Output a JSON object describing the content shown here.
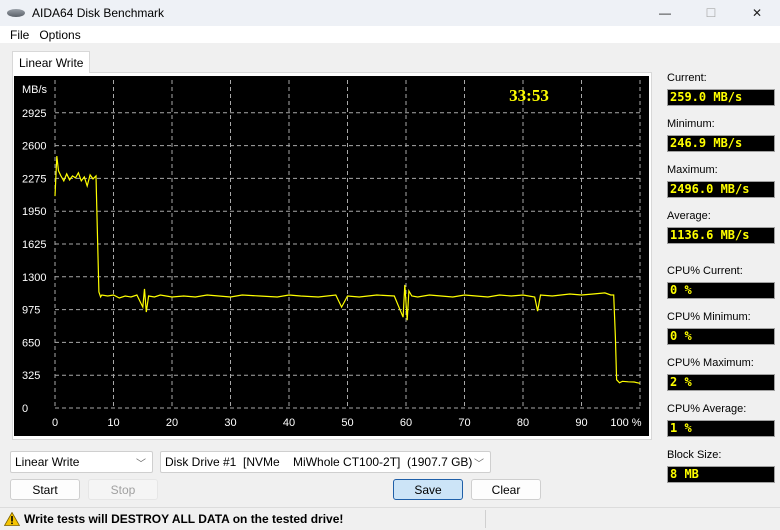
{
  "window": {
    "title": "AIDA64 Disk Benchmark",
    "controls": {
      "minimize": "—",
      "maximize": "☐",
      "close": "✕"
    }
  },
  "menu": [
    "File",
    "Options"
  ],
  "tab": {
    "label": "Linear Write"
  },
  "chart_data": {
    "type": "line",
    "title": "",
    "timer": "33:53",
    "ylabel": "MB/s",
    "xlabel": "%",
    "ylim": [
      0,
      3250
    ],
    "xlim": [
      0,
      100
    ],
    "yticks": [
      "0",
      "325",
      "650",
      "975",
      "1300",
      "1625",
      "1950",
      "2275",
      "2600",
      "2925"
    ],
    "yticks_values": [
      0,
      325,
      650,
      975,
      1300,
      1625,
      1950,
      2275,
      2600,
      2925
    ],
    "xticks": [
      "0",
      "10",
      "20",
      "30",
      "40",
      "50",
      "60",
      "70",
      "80",
      "90",
      "100 %"
    ],
    "xticks_values": [
      0,
      10,
      20,
      30,
      40,
      50,
      60,
      70,
      80,
      90,
      100
    ],
    "grid": true,
    "line_color": "#ffff00",
    "series": [
      {
        "name": "Linear Write",
        "x": [
          0,
          0.3,
          0.6,
          1,
          1.5,
          2,
          2.5,
          3,
          3.5,
          4,
          4.5,
          5,
          5.5,
          6,
          6.5,
          7,
          7.3,
          7.5,
          7.8,
          8,
          9,
          10,
          11,
          12,
          13,
          14,
          15,
          15.3,
          15.6,
          16,
          17,
          18,
          20,
          22,
          24,
          26,
          28,
          30,
          32,
          35,
          38,
          40,
          42,
          45,
          48,
          49,
          50,
          52,
          55,
          58,
          59.5,
          59.8,
          60.2,
          60.5,
          61,
          62,
          64,
          66,
          68,
          70,
          72,
          74,
          76,
          78,
          80,
          82,
          82.5,
          83,
          85,
          88,
          90,
          92,
          94,
          95,
          95.5,
          95.8,
          96,
          96.5,
          97,
          98,
          99,
          100
        ],
        "y": [
          2100,
          2496,
          2350,
          2300,
          2250,
          2320,
          2260,
          2300,
          2280,
          2330,
          2250,
          2290,
          2200,
          2310,
          2270,
          2300,
          1620,
          1150,
          1100,
          1120,
          1110,
          1120,
          1090,
          1110,
          1100,
          1120,
          1000,
          1180,
          950,
          1110,
          1100,
          1120,
          1100,
          1110,
          1100,
          1120,
          1110,
          1100,
          1120,
          1110,
          1100,
          1120,
          1110,
          1100,
          1120,
          1000,
          1110,
          1100,
          1120,
          1110,
          900,
          1220,
          870,
          1160,
          1110,
          1100,
          1120,
          1110,
          1100,
          1120,
          1110,
          1100,
          1120,
          1110,
          1120,
          1100,
          960,
          1120,
          1110,
          1130,
          1120,
          1130,
          1140,
          1120,
          1120,
          700,
          280,
          250,
          265,
          260,
          258,
          245
        ]
      }
    ]
  },
  "stats": [
    {
      "label": "Current:",
      "value": "259.0 MB/s"
    },
    {
      "label": "Minimum:",
      "value": "246.9 MB/s"
    },
    {
      "label": "Maximum:",
      "value": "2496.0 MB/s"
    },
    {
      "label": "Average:",
      "value": "1136.6 MB/s"
    },
    {
      "label": "CPU% Current:",
      "value": "0 %"
    },
    {
      "label": "CPU% Minimum:",
      "value": "0 %"
    },
    {
      "label": "CPU% Maximum:",
      "value": "2 %"
    },
    {
      "label": "CPU% Average:",
      "value": "1 %"
    },
    {
      "label": "Block Size:",
      "value": "8 MB"
    }
  ],
  "controls": {
    "test_select": "Linear Write",
    "drive_select": "Disk Drive #1  [NVMe    MiWhole CT100-2T]  (1907.7 GB)",
    "start": "Start",
    "stop": "Stop",
    "save": "Save",
    "clear": "Clear"
  },
  "status": {
    "text": "Write tests will DESTROY ALL DATA on the tested drive!"
  }
}
